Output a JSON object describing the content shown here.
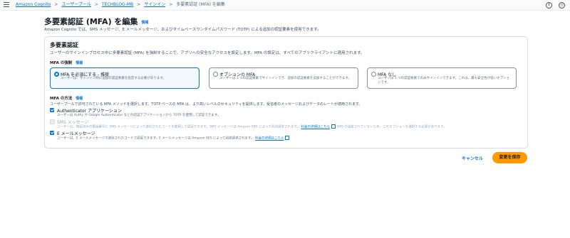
{
  "breadcrumbs": [
    "Amazon Cognito",
    "ユーザープール",
    "TECHBLOG-MB",
    "サインイン",
    "多要素認証 (MFA) を編集"
  ],
  "page": {
    "title": "多要素認証 (MFA) を編集",
    "info": "情報",
    "description": "Amazon Cognito では、SMS メッセージ、E メールメッセージ、およびタイムベースワンタイムパスワード (TOTP) による追加の認証要素を使用できます。"
  },
  "panel": {
    "title": "多要素認証",
    "description": "ユーザーのサインインプロセス中に多要素認証 (MFA) を強制することで、アプリへの安全なアクセスを設定します。MFA の設定は、すべてのアプリクライアントに適用されます。",
    "enforcement": {
      "label": "MFA の強制",
      "info": "情報",
      "options": [
        {
          "title": "MFA を必須にする - 推奨",
          "description": "ユーザーは、サインイン時に追加の認証要素を指定する必要があります。",
          "selected": true
        },
        {
          "title": "オプションの MFA",
          "description": "ユーザーは 1 つの認証要素でサインインでき、追加の認証要素を追加することができます。",
          "selected": false
        },
        {
          "title": "MFA なし",
          "description": "ユーザーは 1 つの認証要素でのみサインインできます。これは、最も安全性が低いオプションです。",
          "selected": false
        }
      ]
    },
    "methods": {
      "label": "MFA の方法",
      "info": "情報",
      "description": "ユーザープールで許可されている MFA メソッドを選択します。TOTP ベースの MFA は、より高いレベルのセキュリティを提供します。受信者のメッセージおよびデータのレートが適用されます。",
      "authenticator": {
        "label": "Authenticator アプリケーション",
        "description": "ユーザーは Authy や Google Authenticator などの認証アプリケーションから TOTP を使用して認証できます。",
        "checked": true
      },
      "sms": {
        "label": "SMS メッセージ",
        "description": "ユーザーは、検証済みの電話番号に SMS メッセージによって送信されたコードを使用して認証できます。SMS メッセージは Amazon SNS によって別途請求されます。",
        "pricing_link": "料金の詳細はこちら",
        "suffix": "SMS が設定されていないため、このオプションを選択する必要があります。",
        "checked": false,
        "disabled": true
      },
      "email": {
        "label": "E メールメッセージ",
        "description": "ユーザーは、E メールメッセージで送信されたコードで認証できます。E メールメッセージは Amazon SES によって別途請求されます。",
        "pricing_link": "料金の詳細はこちら",
        "checked": true
      }
    }
  },
  "actions": {
    "cancel": "キャンセル",
    "save": "変更を保存"
  },
  "colors": {
    "accent": "#0972d3",
    "primary_button": "#ff9900"
  }
}
